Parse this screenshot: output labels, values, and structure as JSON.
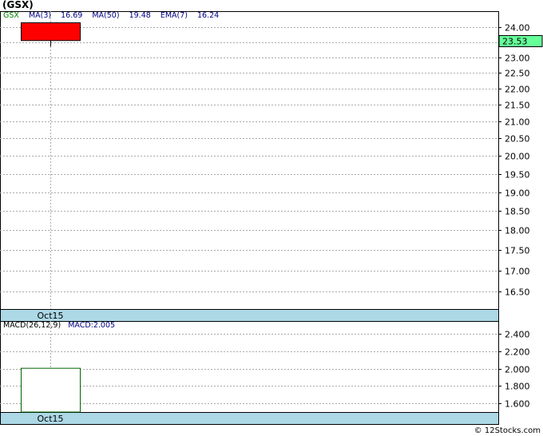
{
  "title": "(GSX)",
  "legend": {
    "ticker": "GSX",
    "ma3_label": "MA(3)",
    "ma3_value": "16.69",
    "ma50_label": "MA(50)",
    "ma50_value": "19.48",
    "ema7_label": "EMA(7)",
    "ema7_value": "16.24"
  },
  "macd_legend": {
    "label": "MACD(26,12,9)",
    "value": "MACD:2.005"
  },
  "copyright": "© 12Stocks.com",
  "colors": {
    "up_candle": "#ff0000",
    "grid": "#aaaaaa",
    "date_band": "#add8e6",
    "price_marker": "#66ff99"
  },
  "chart_data": [
    {
      "type": "candlestick",
      "name": "price",
      "categories": [
        "Oct15"
      ],
      "candles": [
        {
          "date": "Oct15",
          "open": 23.55,
          "high": 24.15,
          "low": 23.35,
          "close": 24.15
        }
      ],
      "last_price_label": "23.53",
      "last_price": 23.53,
      "ylim": [
        16.1,
        24.55
      ],
      "yticks": [
        "16.50",
        "17.00",
        "17.50",
        "18.00",
        "18.50",
        "19.00",
        "19.50",
        "20.00",
        "20.50",
        "21.00",
        "21.50",
        "22.00",
        "22.50",
        "23.00",
        "23.50",
        "24.00"
      ],
      "ytick_values": [
        16.5,
        17.0,
        17.5,
        18.0,
        18.5,
        19.0,
        19.5,
        20.0,
        20.5,
        21.0,
        21.5,
        22.0,
        22.5,
        23.0,
        23.5,
        24.0
      ],
      "log_scale": true,
      "grid": true,
      "x_tick_label": "Oct15"
    },
    {
      "type": "bar",
      "name": "macd",
      "categories": [
        "Oct15"
      ],
      "values": [
        2.005
      ],
      "ylim": [
        1.5,
        2.55
      ],
      "yticks": [
        "1.600",
        "1.800",
        "2.000",
        "2.200",
        "2.400"
      ],
      "ytick_values": [
        1.6,
        1.8,
        2.0,
        2.2,
        2.4
      ],
      "grid": true,
      "x_tick_label": "Oct15"
    }
  ]
}
